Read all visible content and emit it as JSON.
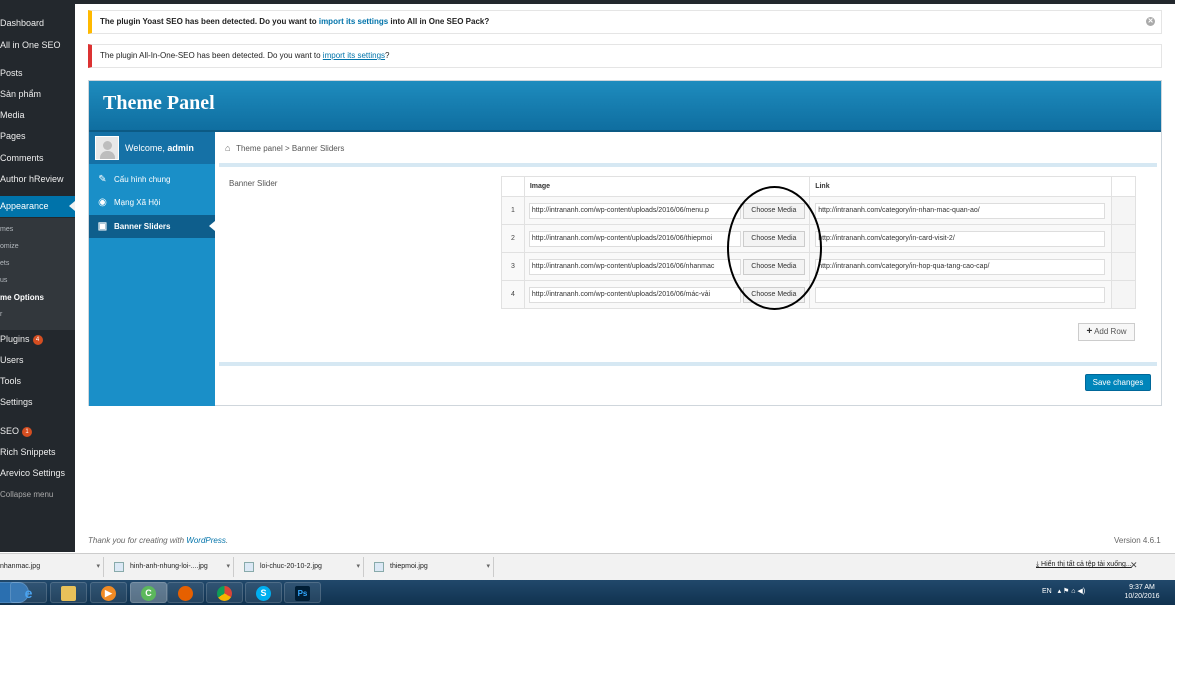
{
  "sidebar": {
    "items": [
      {
        "label": "Dashboard"
      },
      {
        "label": "All in One SEO"
      },
      {
        "label": "Posts"
      },
      {
        "label": "Sản phẩm"
      },
      {
        "label": "Media"
      },
      {
        "label": "Pages"
      },
      {
        "label": "Comments"
      },
      {
        "label": "Author hReview"
      },
      {
        "label": "Appearance"
      },
      {
        "label": "Plugins",
        "badge": "4"
      },
      {
        "label": "Users"
      },
      {
        "label": "Tools"
      },
      {
        "label": "Settings"
      },
      {
        "label": "SEO",
        "badge": "1"
      },
      {
        "label": "Rich Snippets"
      },
      {
        "label": "Arevico Settings"
      },
      {
        "label": "Collapse menu"
      }
    ],
    "submenu": [
      "mes",
      "omize",
      "ets",
      "us",
      "me Options",
      "r"
    ]
  },
  "notices": {
    "yoast": {
      "prefix": "The plugin Yoast SEO has been detected. Do you want to ",
      "link": "import its settings",
      "suffix": " into All in One SEO Pack?"
    },
    "aioseo": {
      "prefix": "The plugin All-In-One-SEO has been detected. Do you want to ",
      "link": "import its settings",
      "suffix": "?"
    }
  },
  "panel": {
    "title": "Theme Panel",
    "welcome_prefix": "Welcome, ",
    "welcome_user": "admin",
    "nav": [
      {
        "label": "Cấu hình chung",
        "icon": "wrench-icon"
      },
      {
        "label": "Mạng Xã Hội",
        "icon": "globe-icon"
      },
      {
        "label": "Banner Sliders",
        "icon": "slider-icon"
      }
    ],
    "breadcrumb": {
      "root": "Theme panel",
      "sep": ">",
      "current": "Banner Sliders"
    },
    "field_label": "Banner Slider",
    "table": {
      "headers": {
        "image": "Image",
        "link": "Link"
      },
      "choose_label": "Choose Media",
      "rows": [
        {
          "num": "1",
          "image": "http://intrananh.com/wp-content/uploads/2016/06/menu.p",
          "link": "http://intrananh.com/category/in-nhan-mac-quan-ao/"
        },
        {
          "num": "2",
          "image": "http://intrananh.com/wp-content/uploads/2016/06/thiepmoi",
          "link": "http://intrananh.com/category/in-card-visit-2/"
        },
        {
          "num": "3",
          "image": "http://intrananh.com/wp-content/uploads/2016/06/nhanmac",
          "link": "http://intrananh.com/category/in-hop-qua-tang-cao-cap/"
        },
        {
          "num": "4",
          "image": "http://intrananh.com/wp-content/uploads/2016/06/mác-vải",
          "link": ""
        }
      ]
    },
    "add_row": "Add Row",
    "save": "Save changes"
  },
  "footer": {
    "prefix": "Thank you for creating with ",
    "link": "WordPress",
    "suffix": ".",
    "version": "Version 4.6.1"
  },
  "downloads": {
    "items": [
      "nhanmac.jpg",
      "hinh-anh-nhung-loi-....jpg",
      "loi-chuc-20-10-2.jpg",
      "thiepmoi.jpg"
    ],
    "show_all": "Hiển thị tất cả tệp tải xuống...",
    "close": "✕"
  },
  "taskbar": {
    "lang": "EN",
    "time": "9:37 AM",
    "date": "10/20/2016"
  },
  "colors": {
    "wp_sidebar": "#23282d",
    "wp_active": "#0073aa",
    "panel_blue": "#1a8fc8",
    "save_button": "#0085ba"
  }
}
